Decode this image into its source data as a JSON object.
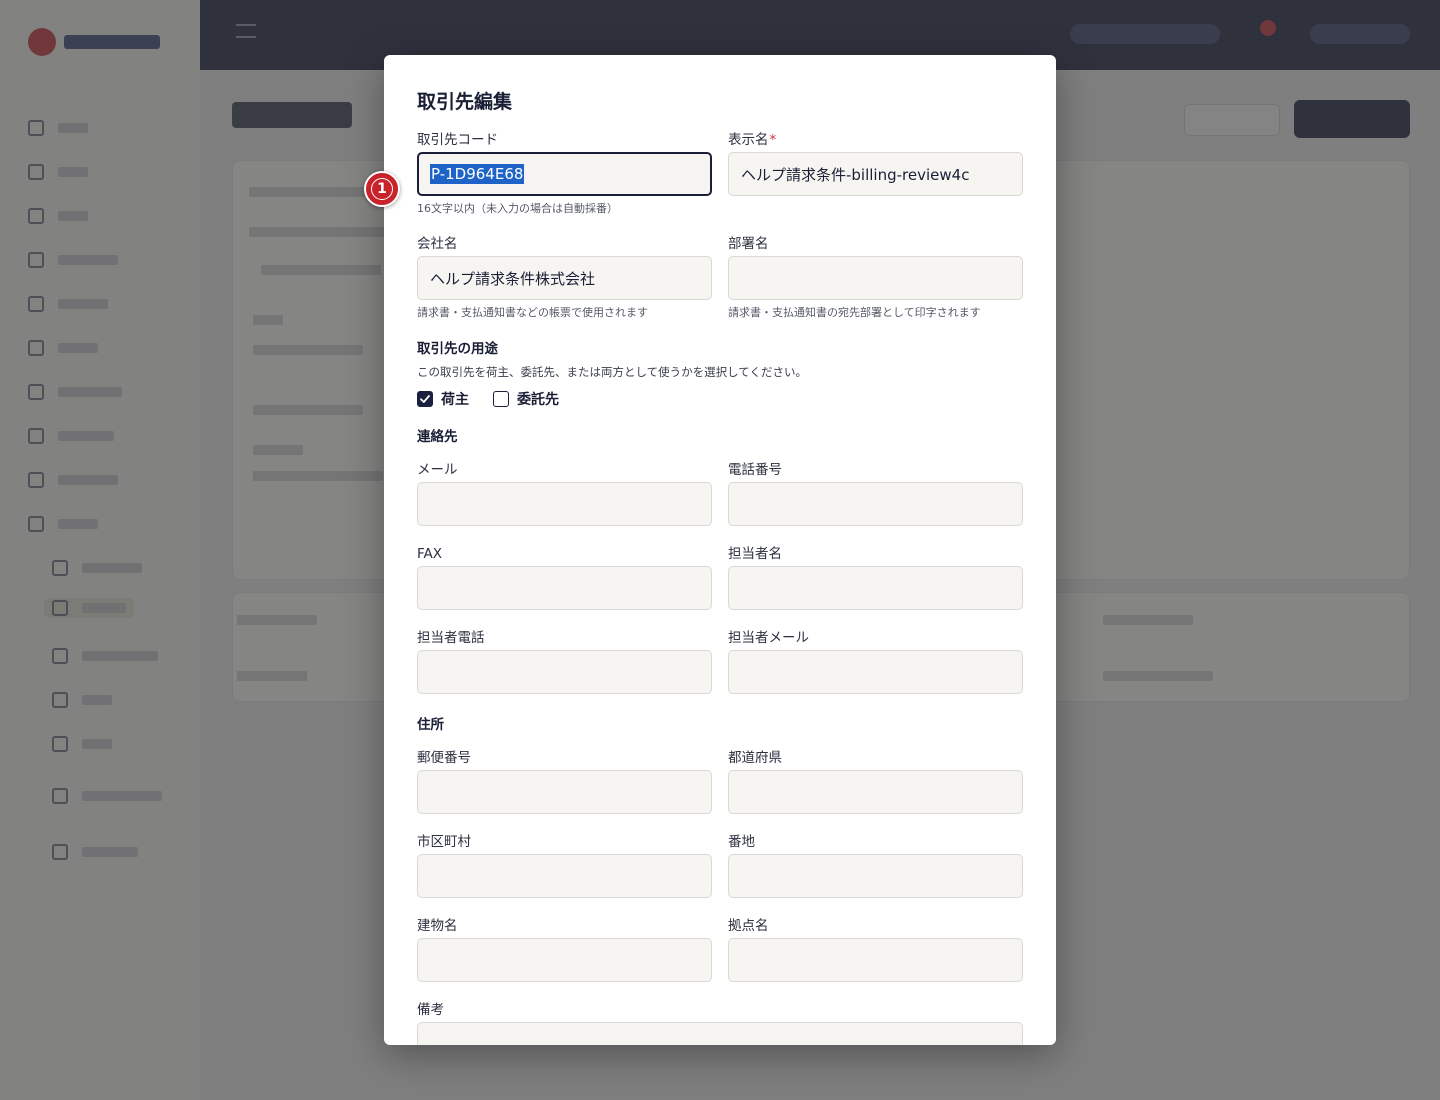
{
  "modal": {
    "title": "取引先編集",
    "code": {
      "label": "取引先コード",
      "value": "P-1D964E68",
      "hint": "16文字以内（未入力の場合は自動採番）"
    },
    "display_name": {
      "label": "表示名",
      "required_mark": "*",
      "value": "ヘルプ請求条件-billing-review4c"
    },
    "company": {
      "label": "会社名",
      "value": "ヘルプ請求条件株式会社",
      "hint": "請求書・支払通知書などの帳票で使用されます"
    },
    "department": {
      "label": "部署名",
      "value": "",
      "hint": "請求書・支払通知書の宛先部署として印字されます"
    },
    "usage": {
      "title": "取引先の用途",
      "description": "この取引先を荷主、委託先、または両方として使うかを選択してください。",
      "shipper": {
        "label": "荷主",
        "checked": true
      },
      "contractor": {
        "label": "委託先",
        "checked": false
      }
    },
    "contact": {
      "title": "連絡先",
      "email": {
        "label": "メール",
        "value": ""
      },
      "phone": {
        "label": "電話番号",
        "value": ""
      },
      "fax": {
        "label": "FAX",
        "value": ""
      },
      "person": {
        "label": "担当者名",
        "value": ""
      },
      "person_phone": {
        "label": "担当者電話",
        "value": ""
      },
      "person_email": {
        "label": "担当者メール",
        "value": ""
      }
    },
    "address": {
      "title": "住所",
      "postal": {
        "label": "郵便番号",
        "value": ""
      },
      "prefecture": {
        "label": "都道府県",
        "value": ""
      },
      "city": {
        "label": "市区町村",
        "value": ""
      },
      "street": {
        "label": "番地",
        "value": ""
      },
      "building": {
        "label": "建物名",
        "value": ""
      },
      "site": {
        "label": "拠点名",
        "value": ""
      }
    },
    "notes": {
      "label": "備考",
      "value": ""
    }
  },
  "marker": {
    "label": "1"
  },
  "colors": {
    "primary": "#1a2140",
    "required": "#d0342c",
    "selection": "#1e64c8",
    "marker": "#c8222a",
    "input_bg": "#f6f5f1"
  }
}
